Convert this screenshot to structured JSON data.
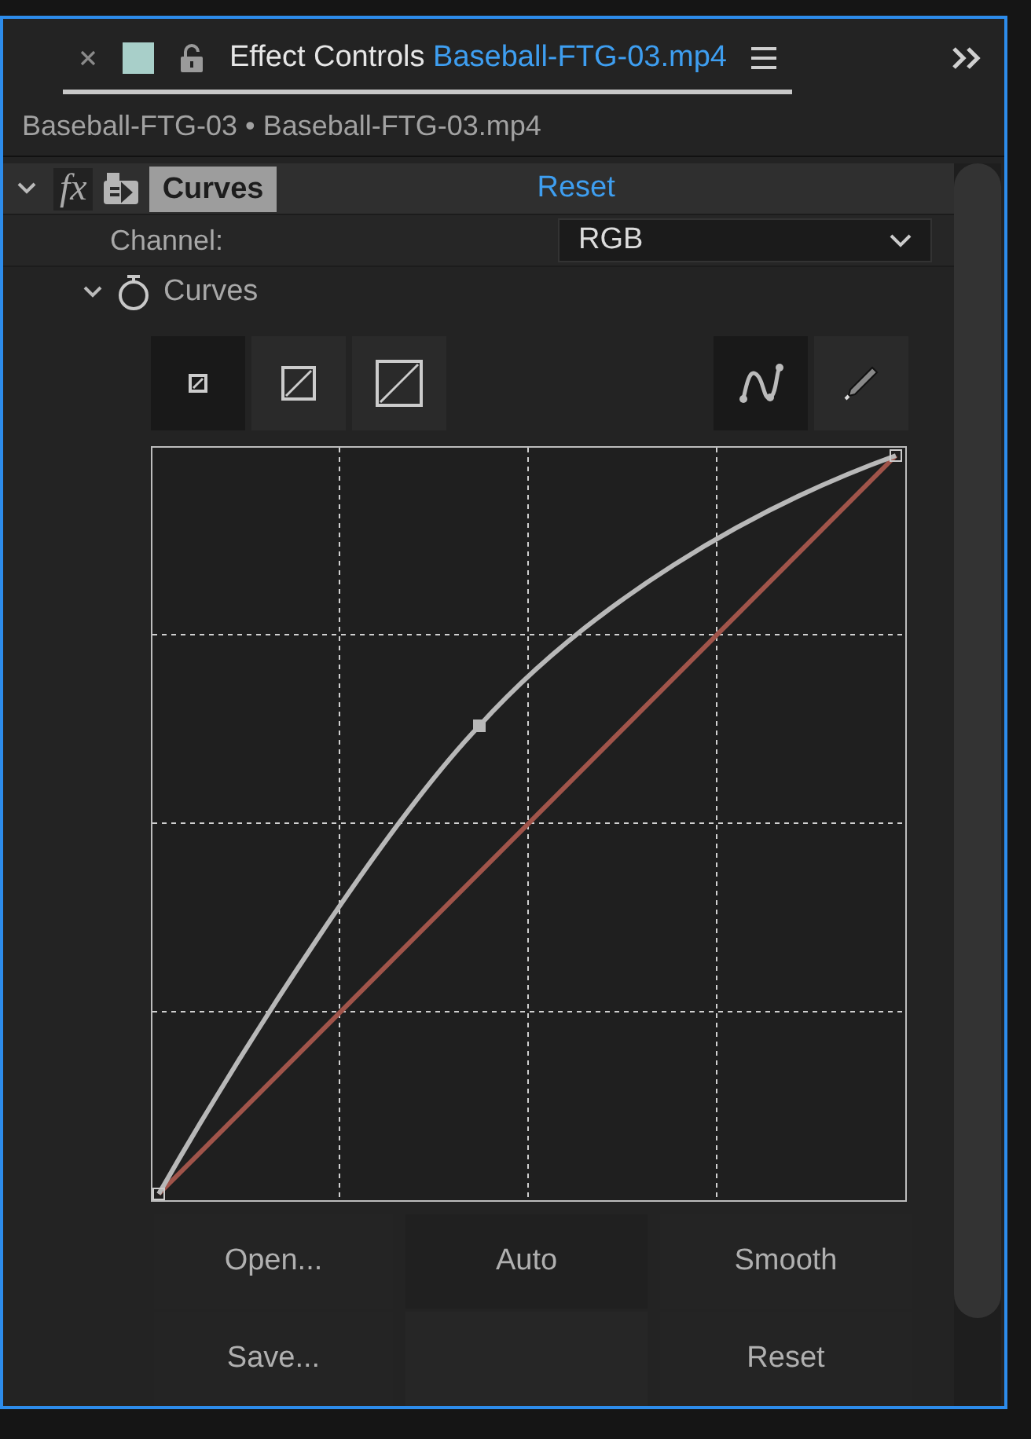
{
  "panel": {
    "tab": {
      "label": "Effect Controls",
      "clip": "Baseball-FTG-03.mp4",
      "selected": true
    }
  },
  "breadcrumb": "Baseball-FTG-03 • Baseball-FTG-03.mp4",
  "effect": {
    "fx": "fx",
    "name": "Curves",
    "reset": "Reset",
    "expanded": true
  },
  "channel": {
    "label": "Channel:",
    "value": "RGB"
  },
  "curves": {
    "label": "Curves",
    "expanded": true
  },
  "buttons": [
    [
      {
        "kind": "button",
        "label": "Open..."
      },
      {
        "kind": "button",
        "label": "Auto"
      },
      {
        "kind": "button",
        "label": "Smooth"
      }
    ],
    [
      {
        "kind": "button",
        "label": "Save..."
      },
      {
        "kind": "blank"
      },
      {
        "kind": "button",
        "label": "Reset"
      }
    ]
  ]
}
